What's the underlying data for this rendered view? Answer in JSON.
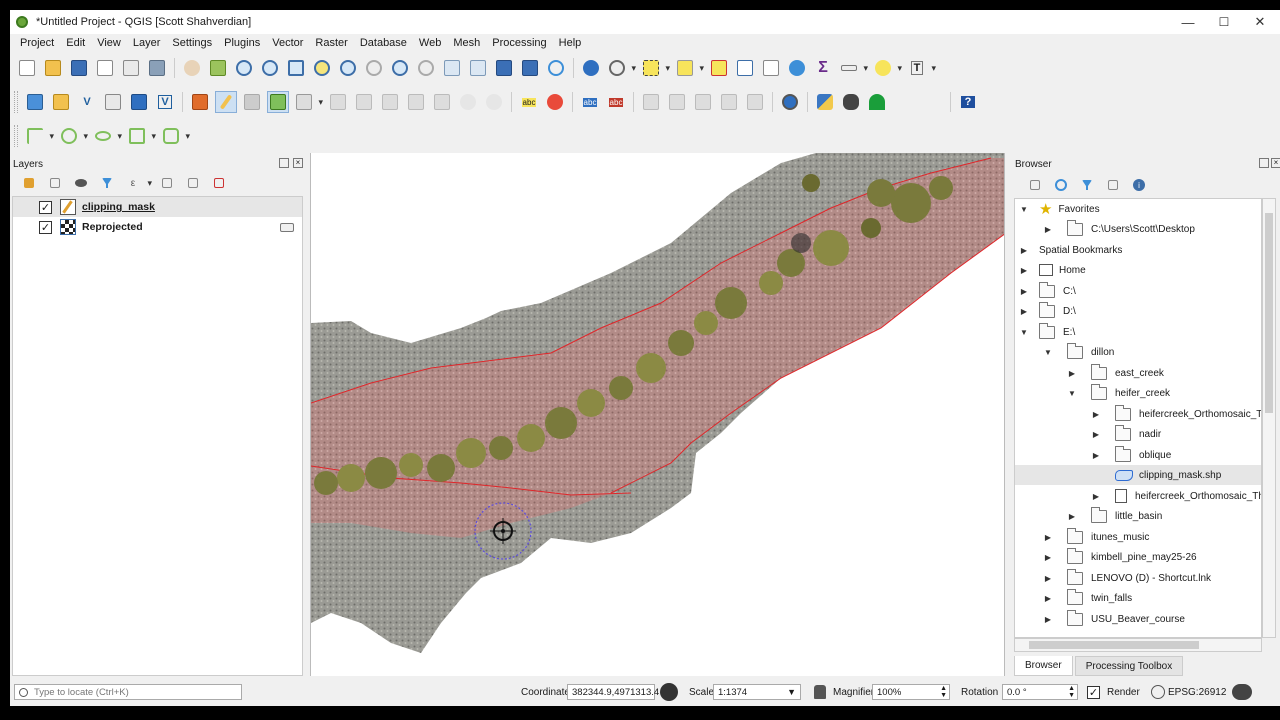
{
  "window": {
    "title": "*Untitled Project - QGIS [Scott Shahverdian]",
    "min": "—",
    "max": "☐",
    "close": "✕"
  },
  "menu": [
    "Project",
    "Edit",
    "View",
    "Layer",
    "Settings",
    "Plugins",
    "Vector",
    "Raster",
    "Database",
    "Web",
    "Mesh",
    "Processing",
    "Help"
  ],
  "layers_panel": {
    "title": "Layers",
    "layers": [
      {
        "name": "clipping_mask",
        "checked": "✓",
        "icon": "polygon-edit-icon"
      },
      {
        "name": "Reprojected",
        "checked": "✓",
        "icon": "raster-icon"
      }
    ]
  },
  "browser_panel": {
    "title": "Browser",
    "items": [
      {
        "label": "Favorites",
        "icon": "star-icon",
        "arrow": "▼"
      },
      {
        "label": "C:\\Users\\Scott\\Desktop",
        "icon": "folder-icon",
        "arrow": "▶"
      },
      {
        "label": "Spatial Bookmarks",
        "icon": "bookmark-icon",
        "arrow": "▶"
      },
      {
        "label": "Home",
        "icon": "home-icon",
        "arrow": "▶"
      },
      {
        "label": "C:\\",
        "icon": "folder-icon",
        "arrow": "▶"
      },
      {
        "label": "D:\\",
        "icon": "folder-icon",
        "arrow": "▶"
      },
      {
        "label": "E:\\",
        "icon": "folder-icon",
        "arrow": "▼"
      },
      {
        "label": "dillon",
        "icon": "folder-icon",
        "arrow": "▼"
      },
      {
        "label": "east_creek",
        "icon": "folder-icon",
        "arrow": "▶"
      },
      {
        "label": "heifer_creek",
        "icon": "folder-icon",
        "arrow": "▼"
      },
      {
        "label": "heifercreek_Orthomosaic_ThuJ",
        "icon": "folder-icon",
        "arrow": "▶"
      },
      {
        "label": "nadir",
        "icon": "folder-icon",
        "arrow": "▶"
      },
      {
        "label": "oblique",
        "icon": "folder-icon",
        "arrow": "▶"
      },
      {
        "label": "clipping_mask.shp",
        "icon": "polygon-icon",
        "arrow": ""
      },
      {
        "label": "heifercreek_Orthomosaic_ThuJ",
        "icon": "raster-file-icon",
        "arrow": "▶"
      },
      {
        "label": "little_basin",
        "icon": "folder-icon",
        "arrow": "▶"
      },
      {
        "label": "itunes_music",
        "icon": "folder-icon",
        "arrow": "▶"
      },
      {
        "label": "kimbell_pine_may25-26",
        "icon": "folder-icon",
        "arrow": "▶"
      },
      {
        "label": "LENOVO (D) - Shortcut.lnk",
        "icon": "shortcut-icon",
        "arrow": "▶"
      },
      {
        "label": "twin_falls",
        "icon": "folder-icon",
        "arrow": "▶"
      },
      {
        "label": "USU_Beaver_course",
        "icon": "folder-icon",
        "arrow": "▶"
      }
    ],
    "tabs": [
      "Browser",
      "Processing Toolbox"
    ]
  },
  "statusbar": {
    "locate_placeholder": "Type to locate (Ctrl+K)",
    "coordinate_label": "Coordinate",
    "coordinate_value": "382344.9,4971313.4",
    "scale_label": "Scale",
    "scale_value": "1:1374",
    "magnifier_label": "Magnifier",
    "magnifier_value": "100%",
    "rotation_label": "Rotation",
    "rotation_value": "0.0 °",
    "render_label": "Render",
    "render_checked": "✓",
    "crs": "EPSG:26912"
  },
  "colors": {
    "accent": "#2e6bd1",
    "mask_outline": "#e0262a",
    "mask_fill": "#d9827e"
  }
}
